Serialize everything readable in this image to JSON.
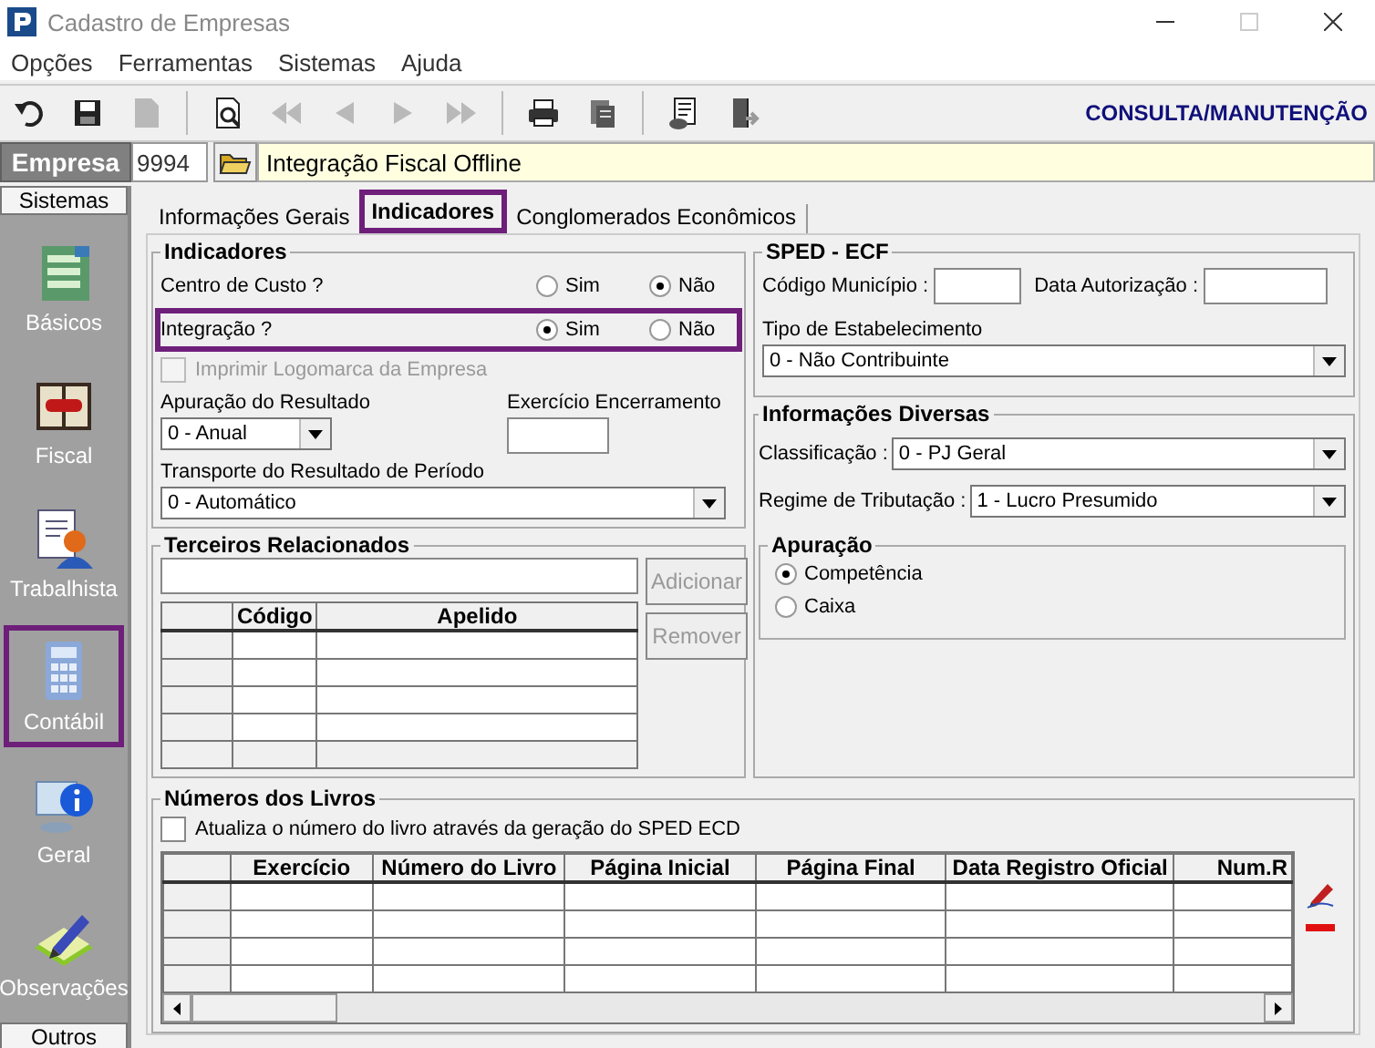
{
  "window": {
    "title": "Cadastro de Empresas"
  },
  "menu": [
    "Opções",
    "Ferramentas",
    "Sistemas",
    "Ajuda"
  ],
  "toolbar": {
    "buttons": [
      {
        "kind": "undo",
        "disabled": false
      },
      {
        "kind": "save",
        "disabled": false
      },
      {
        "kind": "document",
        "disabled": true
      },
      {
        "kind": "preview",
        "disabled": false
      },
      {
        "kind": "first",
        "disabled": true
      },
      {
        "kind": "previous",
        "disabled": true
      },
      {
        "kind": "next",
        "disabled": true
      },
      {
        "kind": "last",
        "disabled": true
      },
      {
        "kind": "print",
        "disabled": false
      },
      {
        "kind": "stack",
        "disabled": false
      },
      {
        "kind": "report",
        "disabled": false
      },
      {
        "kind": "exit",
        "disabled": false
      }
    ],
    "mode": "CONSULTA/MANUTENÇÃO"
  },
  "empresa": {
    "label": "Empresa",
    "code": "9994",
    "name": "Integração Fiscal Offline"
  },
  "sidebar": {
    "header": "Sistemas",
    "items": [
      {
        "label": "Básicos",
        "kind": "form",
        "highlighted": false
      },
      {
        "label": "Fiscal",
        "kind": "book",
        "highlighted": false
      },
      {
        "label": "Trabalhista",
        "kind": "person",
        "highlighted": false
      },
      {
        "label": "Contábil",
        "kind": "calculator",
        "highlighted": true
      },
      {
        "label": "Geral",
        "kind": "info",
        "highlighted": false
      },
      {
        "label": "Observações",
        "kind": "pencil",
        "highlighted": false
      }
    ],
    "footer": "Outros"
  },
  "tabs": [
    {
      "label": "Informações Gerais",
      "selected": false,
      "highlighted": false
    },
    {
      "label": "Indicadores",
      "selected": true,
      "highlighted": true
    },
    {
      "label": "Conglomerados Econômicos",
      "selected": false,
      "highlighted": false
    }
  ],
  "indicadores": {
    "title": "Indicadores",
    "questions": [
      {
        "label": "Centro de Custo ?",
        "highlighted": false,
        "options": [
          {
            "label": "Sim",
            "selected": false
          },
          {
            "label": "Não",
            "selected": true
          }
        ]
      },
      {
        "label": "Integração ?",
        "highlighted": true,
        "options": [
          {
            "label": "Sim",
            "selected": true
          },
          {
            "label": "Não",
            "selected": false
          }
        ]
      }
    ],
    "print_logo": {
      "label": "Imprimir Logomarca da Empresa",
      "checked": false,
      "disabled": true
    },
    "apuracao_resultado": {
      "label": "Apuração do Resultado",
      "value": "0 - Anual"
    },
    "exercicio_encerramento": {
      "label": "Exercício Encerramento"
    },
    "transporte": {
      "label": "Transporte do Resultado de Período",
      "value": "0 - Automático"
    }
  },
  "terceiros": {
    "title": "Terceiros Relacionados",
    "columns": [
      "Código",
      "Apelido"
    ],
    "buttons": [
      {
        "label": "Adicionar",
        "disabled": true
      },
      {
        "label": "Remover",
        "disabled": true
      }
    ]
  },
  "sped_ecf": {
    "title": "SPED - ECF",
    "codigo_label": "Código Município :",
    "data_label": "Data Autorização :",
    "tipo_label": "Tipo de Estabelecimento",
    "tipo_value": "0 - Não Contribuinte"
  },
  "diversas": {
    "title": "Informações Diversas",
    "classificacao": {
      "label": "Classificação :",
      "value": "0 - PJ Geral"
    },
    "regime": {
      "label": "Regime de Tributação :",
      "value": "1 - Lucro Presumido"
    },
    "apuracao": {
      "title": "Apuração",
      "options": [
        {
          "label": "Competência",
          "selected": true
        },
        {
          "label": "Caixa",
          "selected": false
        }
      ]
    }
  },
  "livros": {
    "title": "Números dos Livros",
    "update": {
      "label": "Atualiza o número do livro através da geração do SPED ECD",
      "checked": false
    },
    "columns": [
      "Exercício",
      "Número do Livro",
      "Página Inicial",
      "Página Final",
      "Data Registro Oficial",
      "Num.R"
    ]
  }
}
